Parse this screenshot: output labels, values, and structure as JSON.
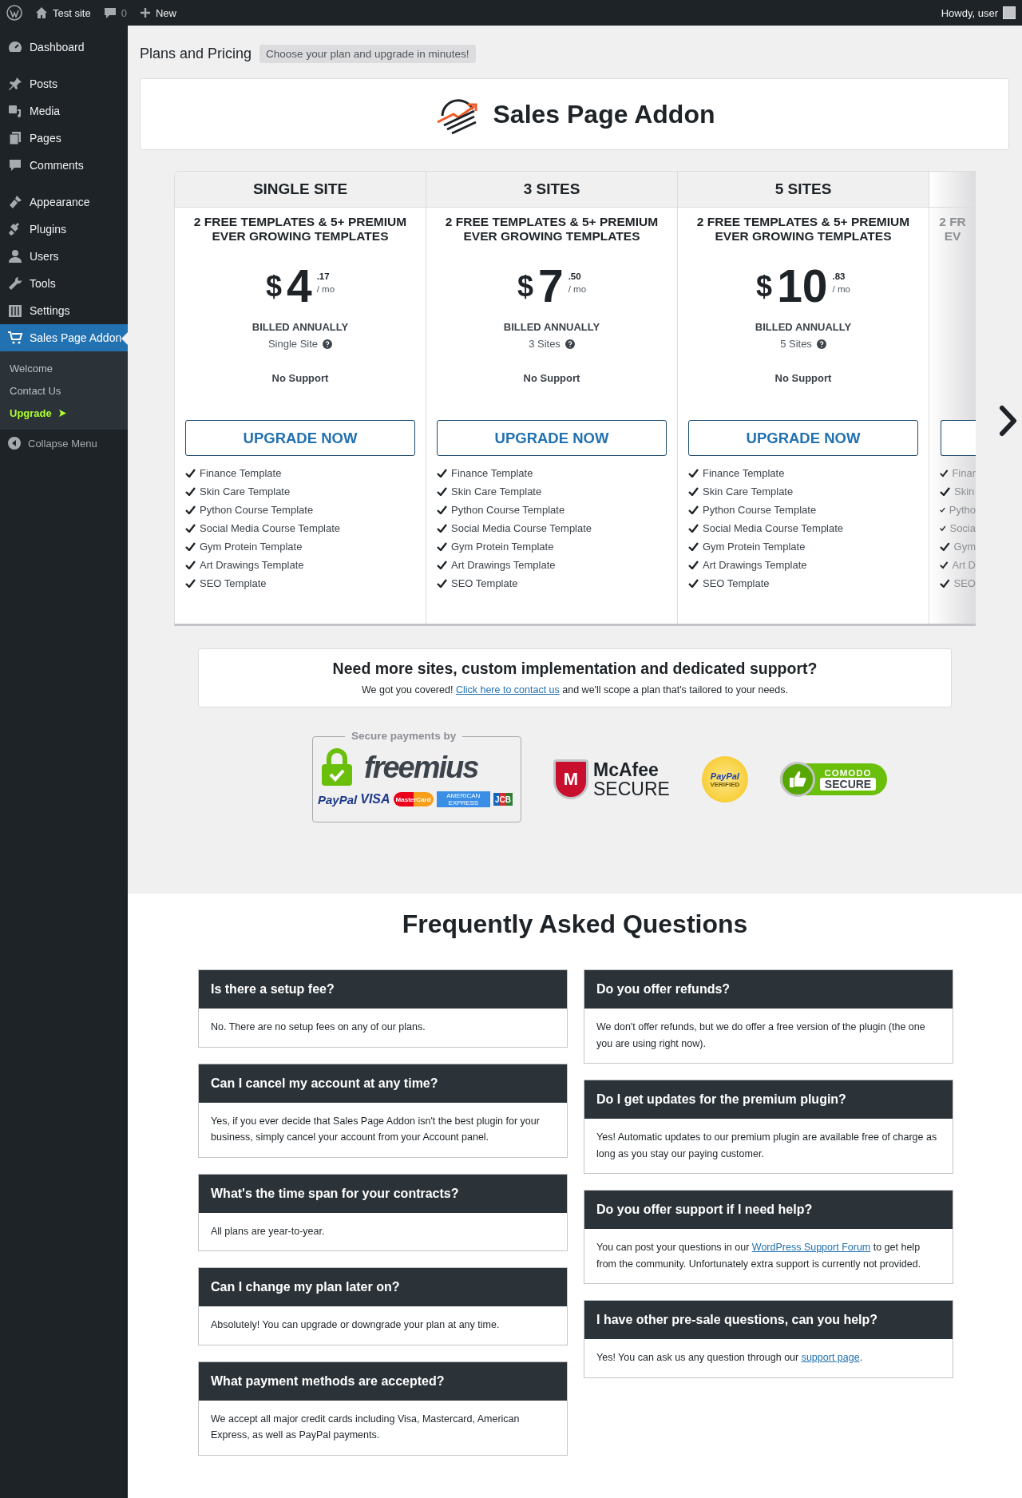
{
  "admin_bar": {
    "site": "Test site",
    "comments": "0",
    "new": "New",
    "greeting": "Howdy, user"
  },
  "sidebar": {
    "groups": [
      {
        "items": [
          {
            "label": "Dashboard",
            "selected": false
          }
        ]
      },
      {
        "items": [
          {
            "label": "Posts",
            "selected": false
          },
          {
            "label": "Media",
            "selected": false
          },
          {
            "label": "Pages",
            "selected": false
          },
          {
            "label": "Comments",
            "selected": false
          }
        ]
      },
      {
        "items": [
          {
            "label": "Appearance",
            "selected": false
          },
          {
            "label": "Plugins",
            "selected": false
          },
          {
            "label": "Users",
            "selected": false
          },
          {
            "label": "Tools",
            "selected": false
          },
          {
            "label": "Settings",
            "selected": false
          },
          {
            "label": "Sales Page Addon",
            "selected": true,
            "children": [
              {
                "label": "Welcome",
                "kind": "link"
              },
              {
                "label": "Contact Us",
                "kind": "link"
              },
              {
                "label": "Upgrade",
                "kind": "upgrade"
              }
            ]
          }
        ]
      }
    ],
    "collapse": "Collapse Menu"
  },
  "page": {
    "title": "Plans and Pricing",
    "subtitle": "Choose your plan and upgrade in minutes!"
  },
  "product": {
    "name": "Sales Page Addon"
  },
  "plans": [
    {
      "name": "SINGLE SITE",
      "description": "2 FREE TEMPLATES & 5+ PREMIUM EVER GROWING TEMPLATES",
      "currency": "$",
      "price": "4",
      "cents": ".17",
      "period": "/ mo",
      "billing": "BILLED ANNUALLY",
      "sites": "Single Site",
      "support": "No Support",
      "button": "UPGRADE NOW",
      "features": [
        "Finance Template",
        "Skin Care Template",
        "Python Course Template",
        "Social Media Course Template",
        "Gym Protein Template",
        "Art Drawings Template",
        "SEO Template"
      ]
    },
    {
      "name": "3 SITES",
      "description": "2 FREE TEMPLATES & 5+ PREMIUM EVER GROWING TEMPLATES",
      "currency": "$",
      "price": "7",
      "cents": ".50",
      "period": "/ mo",
      "billing": "BILLED ANNUALLY",
      "sites": "3 Sites",
      "support": "No Support",
      "button": "UPGRADE NOW",
      "features": [
        "Finance Template",
        "Skin Care Template",
        "Python Course Template",
        "Social Media Course Template",
        "Gym Protein Template",
        "Art Drawings Template",
        "SEO Template"
      ]
    },
    {
      "name": "5 SITES",
      "description": "2 FREE TEMPLATES & 5+ PREMIUM EVER GROWING TEMPLATES",
      "currency": "$",
      "price": "10",
      "cents": ".83",
      "period": "/ mo",
      "billing": "BILLED ANNUALLY",
      "sites": "5 Sites",
      "support": "No Support",
      "button": "UPGRADE NOW",
      "features": [
        "Finance Template",
        "Skin Care Template",
        "Python Course Template",
        "Social Media Course Template",
        "Gym Protein Template",
        "Art Drawings Template",
        "SEO Template"
      ]
    }
  ],
  "partial_plan": {
    "description_lines": [
      "2 FR",
      "EV"
    ],
    "features": [
      "Finar",
      "Skin",
      "Pytho",
      "Socia",
      "Gym",
      "Art D",
      "SEO"
    ]
  },
  "custom_offer": {
    "title": "Need more sites, custom implementation and dedicated support?",
    "text_before": "We got you covered! ",
    "link": "Click here to contact us",
    "text_after": " and we'll scope a plan that's tailored to your needs."
  },
  "trust_badges": {
    "freemius": {
      "caption": "Secure payments by",
      "logo": "freemius",
      "cards": [
        "PayPal",
        "VISA",
        "MasterCard",
        "AMERICAN EXPRESS",
        "JCB"
      ]
    },
    "mcafee": {
      "mark": "M",
      "name": "McAfee",
      "word": "SECURE"
    },
    "paypal": {
      "name": "PayPal",
      "word": "VERIFIED"
    },
    "comodo": {
      "name": "COMODO",
      "word": "SECURE"
    }
  },
  "faq": {
    "title": "Frequently Asked Questions",
    "columns": [
      [
        {
          "question": "Is there a setup fee?",
          "answer": "No. There are no setup fees on any of our plans."
        },
        {
          "question": "Can I cancel my account at any time?",
          "answer": "Yes, if you ever decide that Sales Page Addon isn't the best plugin for your business, simply cancel your account from your Account panel."
        },
        {
          "question": "What's the time span for your contracts?",
          "answer": "All plans are year-to-year."
        },
        {
          "question": "Can I change my plan later on?",
          "answer": "Absolutely! You can upgrade or downgrade your plan at any time."
        },
        {
          "question": "What payment methods are accepted?",
          "answer": "We accept all major credit cards including Visa, Mastercard, American Express, as well as PayPal payments."
        }
      ],
      [
        {
          "question": "Do you offer refunds?",
          "answer": "We don't offer refunds, but we do offer a free version of the plugin (the one you are using right now)."
        },
        {
          "question": "Do I get updates for the premium plugin?",
          "answer": "Yes! Automatic updates to our premium plugin are available free of charge as long as you stay our paying customer."
        },
        {
          "question": "Do you offer support if I need help?",
          "answer": "You can post your questions in our ",
          "link": "WordPress Support Forum",
          "answer_end": " to get help from the community. Unfortunately extra support is currently not provided."
        },
        {
          "question": "I have other pre-sale questions, can you help?",
          "answer": "Yes! You can ask us any question through our ",
          "link": "support page",
          "answer_end": "."
        }
      ]
    ]
  }
}
